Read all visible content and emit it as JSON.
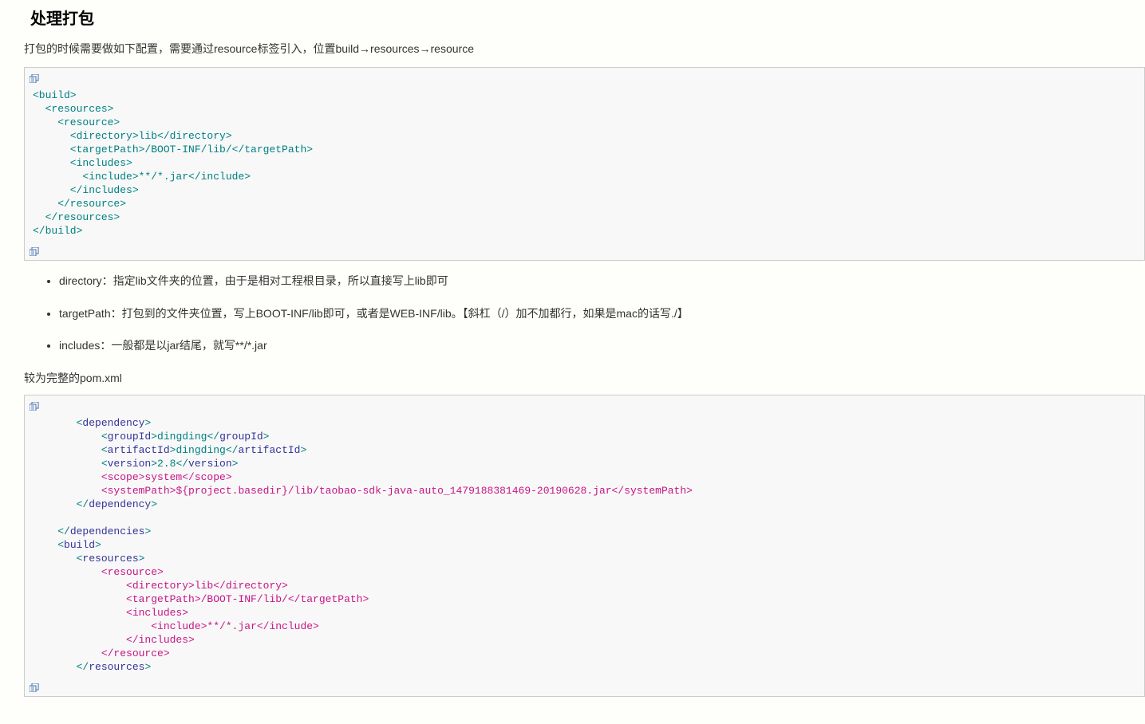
{
  "heading": "处理打包",
  "intro": "打包的时候需要做如下配置，需要通过resource标签引入，位置build→resources→resource",
  "list": {
    "item1": "directory：指定lib文件夹的位置，由于是相对工程根目录，所以直接写上lib即可",
    "item2": "targetPath：打包到的文件夹位置，写上BOOT-INF/lib即可，或者是WEB-INF/lib。【斜杠（/）加不加都行，如果是mac的话写./】",
    "item3": "includes：一般都是以jar结尾，就写**/*.jar"
  },
  "sub_intro": "较为完整的pom.xml",
  "code1": {
    "l1": "<build>",
    "l2": "  <resources>",
    "l3": "    <resource>",
    "l4": "      <directory>lib</directory>",
    "l5": "      <targetPath>/BOOT-INF/lib/</targetPath>",
    "l6": "      <includes>",
    "l7": "        <include>**/*.jar</include>",
    "l8": "      </includes>",
    "l9": "    </resource>",
    "l10": "  </resources>",
    "l11": "</build>"
  },
  "code2": {
    "l1a": "       <",
    "l1b": "dependency",
    "l1c": ">",
    "l2a": "           <",
    "l2b": "groupId",
    "l2c": ">dingding</",
    "l2d": "groupId",
    "l2e": ">",
    "l3a": "           <",
    "l3b": "artifactId",
    "l3c": ">dingding</",
    "l3d": "artifactId",
    "l3e": ">",
    "l4a": "           <",
    "l4b": "version",
    "l4c": ">2.8</",
    "l4d": "version",
    "l4e": ">",
    "l5": "           <scope>system</scope>",
    "l6a": "           <systemPath>",
    "l6b": "${project.basedir}",
    "l6c": "/lib/taobao-sdk-java-auto_1479188381469-20190628.jar</systemPath>",
    "l7a": "       </",
    "l7b": "dependency",
    "l7c": ">",
    "blank": "",
    "l8a": "    </",
    "l8b": "dependencies",
    "l8c": ">",
    "l9a": "    <",
    "l9b": "build",
    "l9c": ">",
    "l10a": "       <",
    "l10b": "resources",
    "l10c": ">",
    "l11": "           <resource>",
    "l12": "               <directory>lib</directory>",
    "l13": "               <targetPath>/BOOT-INF/lib/</targetPath>",
    "l14": "               <includes>",
    "l15": "                   <include>**/*.jar</include>",
    "l16": "               </includes>",
    "l17": "           </resource>",
    "l18a": "       </",
    "l18b": "resources",
    "l18c": ">"
  }
}
